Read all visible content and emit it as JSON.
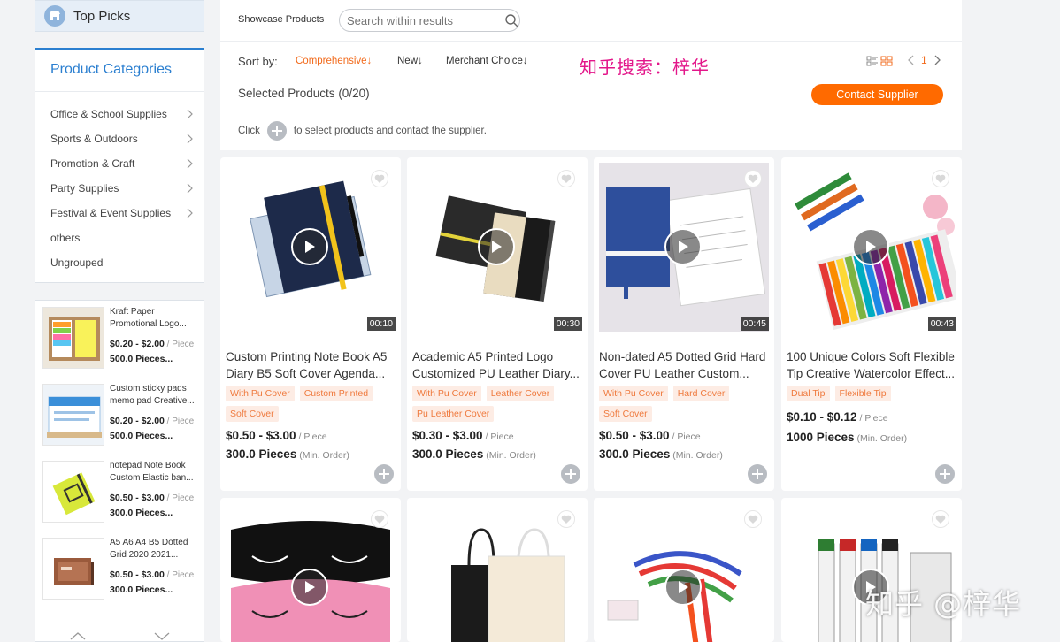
{
  "sidebar": {
    "top_picks": "Top Picks",
    "categories_title": "Product Categories",
    "categories": [
      {
        "label": "Office & School Supplies",
        "has_sub": true
      },
      {
        "label": "Sports & Outdoors",
        "has_sub": true
      },
      {
        "label": "Promotion & Craft",
        "has_sub": true
      },
      {
        "label": "Party Supplies",
        "has_sub": true
      },
      {
        "label": "Festival & Event Supplies",
        "has_sub": true
      },
      {
        "label": "others",
        "has_sub": false
      },
      {
        "label": "Ungrouped",
        "has_sub": false
      }
    ],
    "products": [
      {
        "title": "Kraft Paper Promotional Logo...",
        "price": "$0.20 - $2.00",
        "unit": " / Piece",
        "moq": "500.0 Pieces..."
      },
      {
        "title": "Custom sticky pads memo pad Creative...",
        "price": "$0.20 - $2.00",
        "unit": " / Piece",
        "moq": "500.0 Pieces..."
      },
      {
        "title": "notepad Note Book Custom Elastic ban...",
        "price": "$0.50 - $3.00",
        "unit": " / Piece",
        "moq": "300.0 Pieces..."
      },
      {
        "title": "A5 A6 A4 B5 Dotted Grid 2020 2021...",
        "price": "$0.50 - $3.00",
        "unit": " / Piece",
        "moq": "300.0 Pieces..."
      }
    ]
  },
  "toolbar": {
    "showcase_label": "Showcase Products",
    "search_placeholder": "Search within results",
    "sort_by": "Sort by:",
    "sort_options": [
      "Comprehensive↓",
      "New↓",
      "Merchant Choice↓"
    ],
    "watermark": "知乎搜索：梓华",
    "page": "1",
    "selected": "Selected Products (0/20)",
    "contact_button": "Contact Supplier",
    "hint_before": "Click",
    "hint_after": "to select products and contact the supplier."
  },
  "products": [
    {
      "title": "Custom Printing Note Book A5 Diary B5 Soft Cover Agenda...",
      "duration": "00:10",
      "tags": [
        "With Pu Cover",
        "Custom Printed",
        "Soft Cover"
      ],
      "price": "$0.50 - $3.00",
      "unit": " / Piece",
      "moq": "300.0 Pieces",
      "min_order": " (Min. Order)"
    },
    {
      "title": "Academic A5 Printed Logo Customized PU Leather Diary...",
      "duration": "00:30",
      "tags": [
        "With Pu Cover",
        "Leather Cover",
        "Pu Leather Cover"
      ],
      "price": "$0.30 - $3.00",
      "unit": " / Piece",
      "moq": "300.0 Pieces",
      "min_order": " (Min. Order)"
    },
    {
      "title": "Non-dated A5 Dotted Grid Hard Cover PU Leather Custom...",
      "duration": "00:45",
      "tags": [
        "With Pu Cover",
        "Hard Cover",
        "Soft Cover"
      ],
      "price": "$0.50 - $3.00",
      "unit": " / Piece",
      "moq": "300.0 Pieces",
      "min_order": " (Min. Order)"
    },
    {
      "title": "100 Unique Colors Soft Flexible Tip Creative Watercolor Effect...",
      "duration": "00:43",
      "tags": [
        "Dual Tip",
        "Flexible Tip"
      ],
      "price": "$0.10 - $0.12",
      "unit": " / Piece",
      "moq": "1000 Pieces",
      "min_order": " (Min. Order)"
    }
  ],
  "bottom_watermark": "知乎 @梓华",
  "colors": {
    "accent": "#ff6a00",
    "link_blue": "#2b7fd0",
    "watermark_pink": "#e3168a",
    "tag_bg": "#fdece4"
  }
}
